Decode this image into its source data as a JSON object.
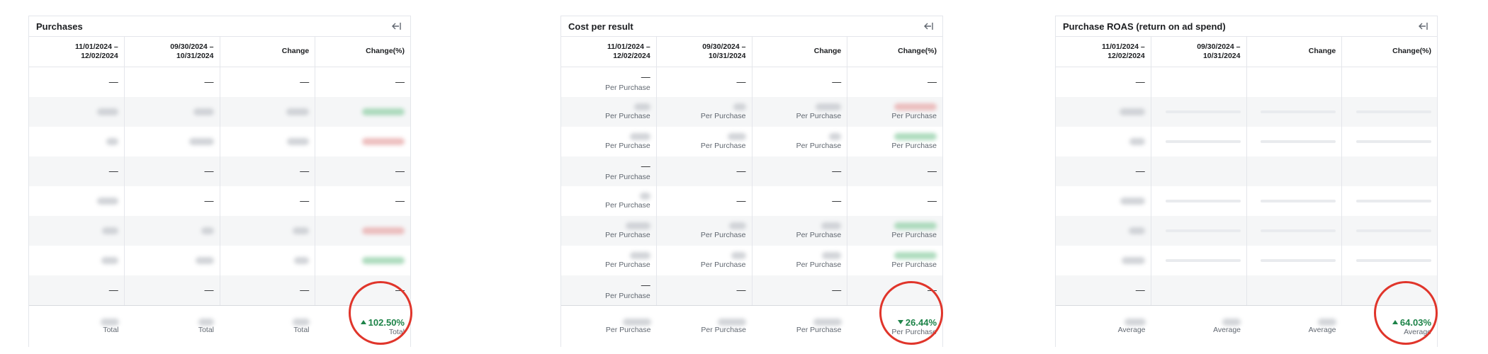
{
  "colors": {
    "positive": "#1d8348",
    "highlight": "#e0352b"
  },
  "icons": {
    "collapse": "collapse-left-icon",
    "up": "triangle-up-icon",
    "down": "triangle-down-icon"
  },
  "columns": [
    "11/01/2024 –\n12/02/2024",
    "09/30/2024 –\n10/31/2024",
    "Change",
    "Change(%)"
  ],
  "dash": "—",
  "purchases": {
    "title": "Purchases",
    "total": {
      "label": "Total",
      "change_pct": "102.50%",
      "direction": "up"
    }
  },
  "cost_per_result": {
    "title": "Cost per result",
    "unit_label": "Per Purchase",
    "total": {
      "label": "Per Purchase",
      "change_pct": "26.44%",
      "direction": "down"
    }
  },
  "roas": {
    "title": "Purchase ROAS (return on ad spend)",
    "total": {
      "label": "Average",
      "change_pct": "64.03%",
      "direction": "up"
    }
  }
}
